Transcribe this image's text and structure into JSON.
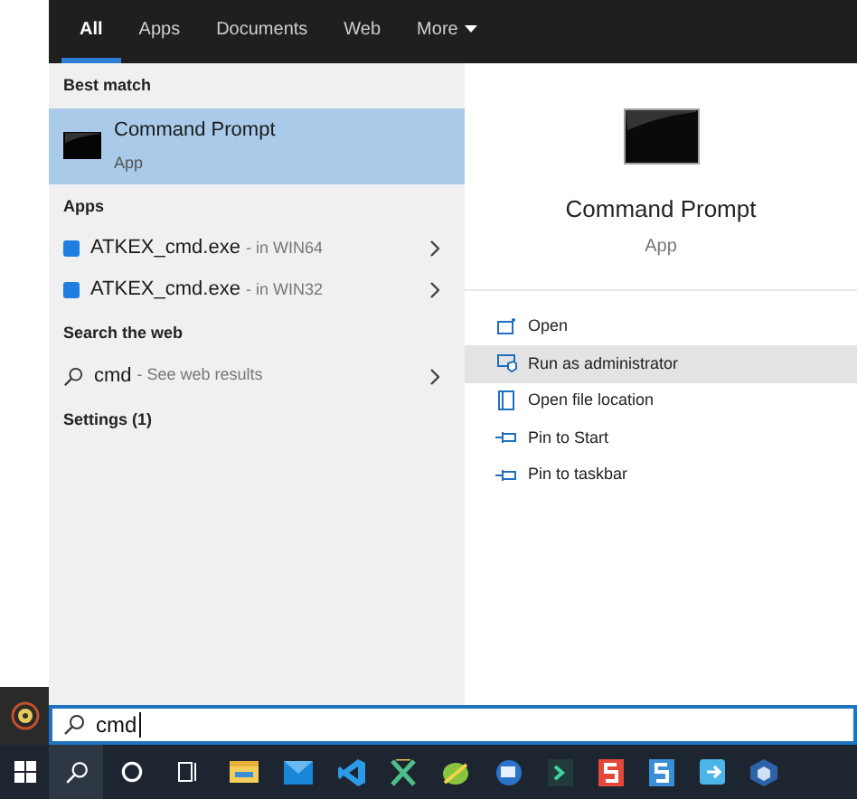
{
  "tabs": [
    {
      "label": "All",
      "selected": true,
      "dropdown": false
    },
    {
      "label": "Apps",
      "selected": false,
      "dropdown": false
    },
    {
      "label": "Documents",
      "selected": false,
      "dropdown": false
    },
    {
      "label": "Web",
      "selected": false,
      "dropdown": false
    },
    {
      "label": "More",
      "selected": false,
      "dropdown": true
    }
  ],
  "results": [
    {
      "kind": "header",
      "text": "Best match"
    },
    {
      "kind": "best",
      "title": "Command Prompt",
      "subtitle": "App",
      "selected": true
    },
    {
      "kind": "header",
      "text": "Apps"
    },
    {
      "kind": "app",
      "title": "ATKEX_cmd.exe",
      "detail": "- in WIN64",
      "selected": false
    },
    {
      "kind": "app",
      "title": "ATKEX_cmd.exe",
      "detail": "- in WIN32",
      "selected": false
    },
    {
      "kind": "header",
      "text": "Search the web"
    },
    {
      "kind": "web",
      "title": "cmd",
      "detail": "- See web results",
      "selected": false
    },
    {
      "kind": "header",
      "text": "Settings (1)"
    }
  ],
  "preview": {
    "title": "Command Prompt",
    "subtitle": "App",
    "actions": [
      {
        "label": "Open",
        "kind": "open",
        "selected": false
      },
      {
        "label": "Run as administrator",
        "kind": "admin",
        "selected": true
      },
      {
        "label": "Open file location",
        "kind": "folder",
        "selected": false
      },
      {
        "label": "Pin to Start",
        "kind": "pin",
        "selected": false
      },
      {
        "label": "Pin to taskbar",
        "kind": "pin",
        "selected": false
      }
    ]
  },
  "search": {
    "value": "cmd"
  }
}
